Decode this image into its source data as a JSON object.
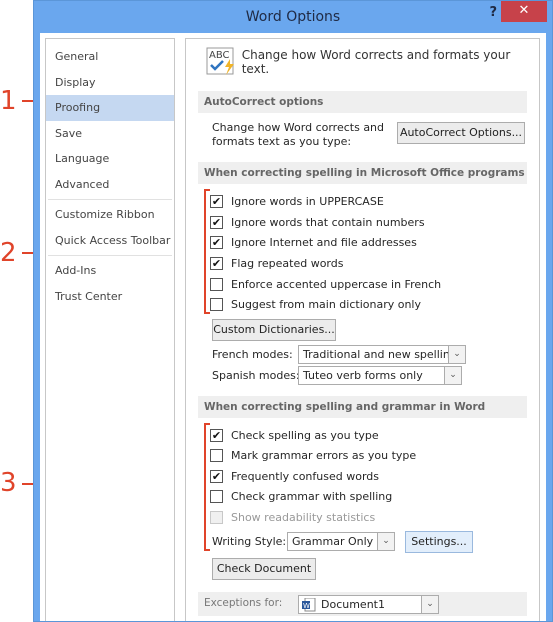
{
  "window": {
    "title": "Word Options",
    "help": "?",
    "close": "✕"
  },
  "nav": {
    "items": [
      {
        "label": "General"
      },
      {
        "label": "Display"
      },
      {
        "label": "Proofing",
        "selected": true
      },
      {
        "label": "Save"
      },
      {
        "label": "Language"
      },
      {
        "label": "Advanced"
      },
      {
        "label": "Customize Ribbon"
      },
      {
        "label": "Quick Access Toolbar"
      },
      {
        "label": "Add-Ins"
      },
      {
        "label": "Trust Center"
      }
    ]
  },
  "main": {
    "header": "Change how Word corrects and formats your text.",
    "autocorrect": {
      "section": "AutoCorrect options",
      "desc_line1": "Change how Word corrects and",
      "desc_line2": "formats text as you type:",
      "button": "AutoCorrect Options..."
    },
    "office": {
      "section": "When correcting spelling in Microsoft Office programs",
      "options": [
        {
          "label": "Ignore words in UPPERCASE",
          "checked": true
        },
        {
          "label": "Ignore words that contain numbers",
          "checked": true
        },
        {
          "label": "Ignore Internet and file addresses",
          "checked": true
        },
        {
          "label": "Flag repeated words",
          "checked": true
        },
        {
          "label": "Enforce accented uppercase in French",
          "checked": false
        },
        {
          "label": "Suggest from main dictionary only",
          "checked": false
        }
      ],
      "custom_dict_button": "Custom Dictionaries...",
      "french_label": "French modes:",
      "french_value": "Traditional and new spellings",
      "spanish_label": "Spanish modes:",
      "spanish_value": "Tuteo verb forms only"
    },
    "word": {
      "section": "When correcting spelling and grammar in Word",
      "options": [
        {
          "label": "Check spelling as you type",
          "checked": true
        },
        {
          "label": "Mark grammar errors as you type",
          "checked": false
        },
        {
          "label": "Frequently confused words",
          "checked": true
        },
        {
          "label": "Check grammar with spelling",
          "checked": false
        },
        {
          "label": "Show readability statistics",
          "checked": false,
          "disabled": true
        }
      ],
      "writing_style_label": "Writing Style:",
      "writing_style_value": "Grammar Only",
      "settings_button": "Settings...",
      "check_doc_button": "Check Document"
    },
    "exceptions": {
      "label": "Exceptions for:",
      "value": "Document1"
    }
  },
  "annotations": {
    "a1": "1",
    "a2": "2",
    "a3": "3"
  },
  "icons": {
    "check": "✔",
    "dropdown": "⌄"
  }
}
